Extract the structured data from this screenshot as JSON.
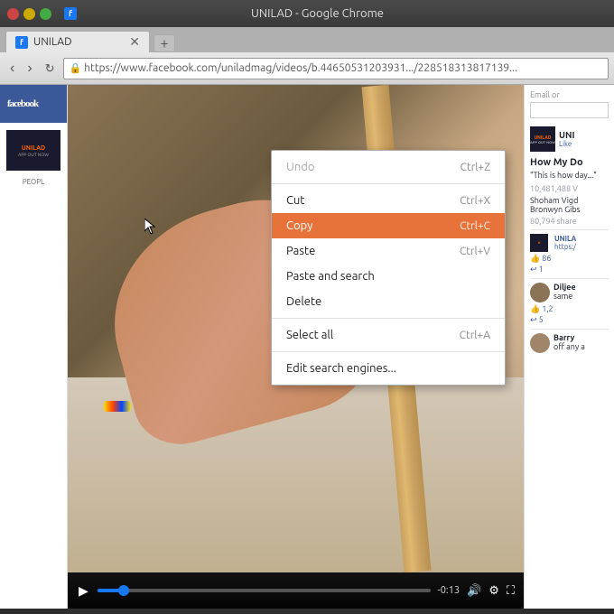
{
  "titlebar": {
    "title": "UNILAD - Google Chrome",
    "favicon_label": "FB"
  },
  "tab": {
    "label": "UNILAD",
    "favicon_label": "f"
  },
  "addressbar": {
    "url": "https://www.facebook.com/uniladmag/videos/b.44650531203931",
    "url_display": "https://www.facebook.com/uniladmag/videos/b.44650531203931.../228518313817139..."
  },
  "context_menu": {
    "items": [
      {
        "id": "undo",
        "label": "Undo",
        "shortcut": "Ctrl+Z",
        "disabled": true,
        "active": false
      },
      {
        "id": "cut",
        "label": "Cut",
        "shortcut": "Ctrl+X",
        "disabled": false,
        "active": false
      },
      {
        "id": "copy",
        "label": "Copy",
        "shortcut": "Ctrl+C",
        "disabled": false,
        "active": true
      },
      {
        "id": "paste",
        "label": "Paste",
        "shortcut": "Ctrl+V",
        "disabled": false,
        "active": false
      },
      {
        "id": "paste-search",
        "label": "Paste and search",
        "shortcut": "",
        "disabled": false,
        "active": false
      },
      {
        "id": "delete",
        "label": "Delete",
        "shortcut": "",
        "disabled": false,
        "active": false
      },
      {
        "id": "select-all",
        "label": "Select all",
        "shortcut": "Ctrl+A",
        "disabled": false,
        "active": false
      },
      {
        "id": "edit-search",
        "label": "Edit search engines...",
        "shortcut": "",
        "disabled": false,
        "active": false
      }
    ]
  },
  "facebook": {
    "logo": "facebook",
    "left_nav": {
      "app_name": "APP",
      "people_label": "PEOPL"
    },
    "right_panel": {
      "email_placeholder": "Email or",
      "page_name": "UNI",
      "like_label": "Like",
      "post_heading": "How My Do",
      "post_excerpt": "\"This is how day...\"",
      "view_count": "10,481,488 V",
      "commenters": "Shoham Vigd Bronwyn Gibs",
      "shares": "80,794 share",
      "comment1_name": "Diljee",
      "comment1_text": "same",
      "comment1_likes": "1,2",
      "comment1_replies": "5",
      "comment2_name": "Barry",
      "comment2_text": "off any a"
    }
  },
  "video_controls": {
    "time": "-0:13",
    "play_icon": "▶",
    "volume_icon": "🔊",
    "settings_icon": "⚙",
    "fullscreen_icon": "⛶"
  }
}
